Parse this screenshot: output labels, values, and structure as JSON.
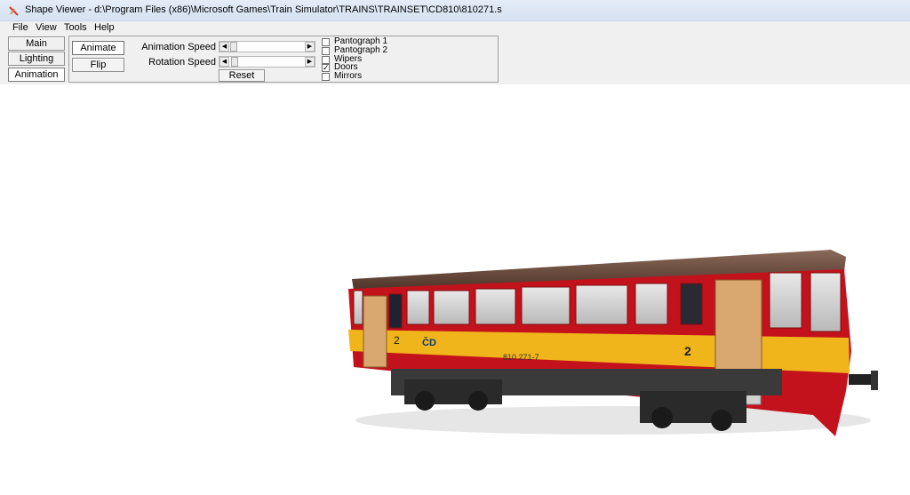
{
  "window": {
    "title": "Shape Viewer - d:\\Program Files (x86)\\Microsoft Games\\Train Simulator\\TRAINS\\TRAINSET\\CD810\\810271.s",
    "icon": "shape-viewer-app-icon"
  },
  "menu": [
    "File",
    "View",
    "Tools",
    "Help"
  ],
  "side_tabs": [
    "Main",
    "Lighting",
    "Animation"
  ],
  "active_tab": "Animation",
  "animation_panel": {
    "animate_label": "Animate",
    "flip_label": "Flip",
    "animation_speed_label": "Animation Speed",
    "rotation_speed_label": "Rotation Speed",
    "reset_label": "Reset",
    "checkboxes": [
      {
        "label": "Pantograph 1",
        "checked": false
      },
      {
        "label": "Pantograph 2",
        "checked": false
      },
      {
        "label": "Wipers",
        "checked": false
      },
      {
        "label": "Doors",
        "checked": true
      },
      {
        "label": "Mirrors",
        "checked": false
      }
    ]
  },
  "model": {
    "unit_number": "810 271-7",
    "class_mark": "2",
    "logo": "ČD",
    "colors": {
      "body_red": "#c3121c",
      "stripe_yellow": "#f0b51a",
      "roof": "#6b4a3c"
    }
  }
}
